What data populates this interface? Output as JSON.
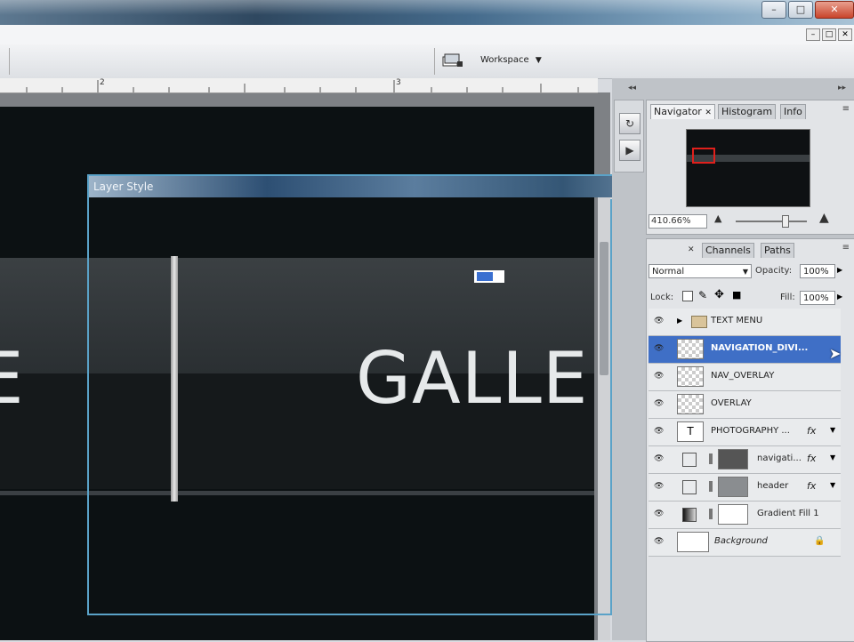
{
  "app": {
    "caption_buttons": {
      "minimize": "–",
      "restore": "□",
      "close": "✕"
    },
    "workspace_label": "Workspace",
    "workspace_arrow": "▼"
  },
  "canvas": {
    "nav_text_left": "E",
    "nav_text_right": "GALLERY",
    "ruler_marks": [
      "2",
      "3"
    ]
  },
  "dialog": {
    "title": "Layer Style",
    "close_label": "✕"
  },
  "tool_strip": {
    "items": [
      "navigator-tool-icon",
      "actions-icon"
    ]
  },
  "navigator_panel": {
    "tabs": [
      "Navigator",
      "Histogram",
      "Info"
    ],
    "zoom_value": "410.66%"
  },
  "layers_panel": {
    "tabs": [
      "Channels",
      "Paths"
    ],
    "blend_mode": "Normal",
    "opacity_label": "Opacity:",
    "opacity_value": "100%",
    "lock_label": "Lock:",
    "fill_label": "Fill:",
    "fill_value": "100%",
    "layers": [
      {
        "name": "TEXT MENU",
        "type": "group",
        "selected": false,
        "fx": false
      },
      {
        "name": "NAVIGATION_DIVI...",
        "type": "pixel",
        "selected": true,
        "fx": false
      },
      {
        "name": "NAV_OVERLAY",
        "type": "pixel",
        "selected": false,
        "fx": false
      },
      {
        "name": "OVERLAY",
        "type": "pixel",
        "selected": false,
        "fx": false
      },
      {
        "name": "PHOTOGRAPHY ...",
        "type": "text",
        "selected": false,
        "fx": true
      },
      {
        "name": "navigati...",
        "type": "shape",
        "selected": false,
        "fx": true
      },
      {
        "name": "header",
        "type": "shape",
        "selected": false,
        "fx": true
      },
      {
        "name": "Gradient Fill 1",
        "type": "fill",
        "selected": false,
        "fx": false
      },
      {
        "name": "Background",
        "type": "background",
        "selected": false,
        "fx": false
      }
    ],
    "fx_label": "fx"
  },
  "colors": {
    "selection_blue": "#3f6fc6",
    "dialog_border": "#5aa2c8",
    "document_bg": "#0c1113"
  }
}
